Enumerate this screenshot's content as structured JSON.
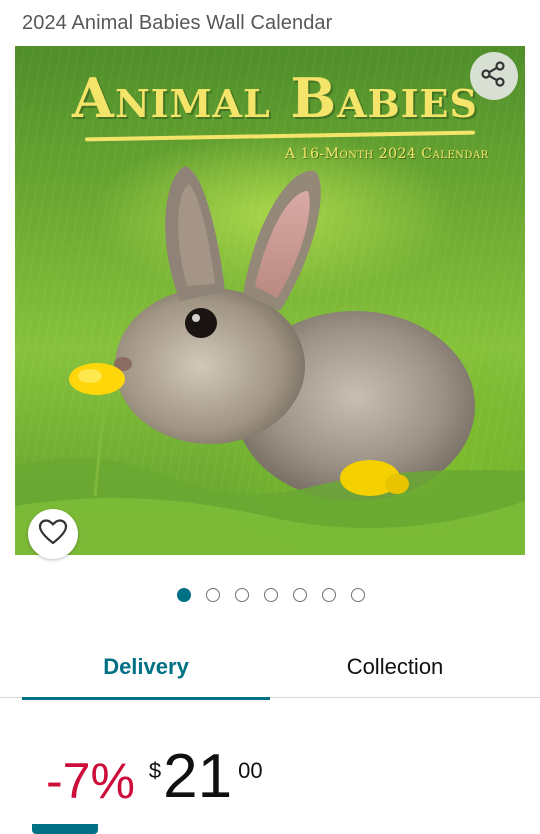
{
  "product": {
    "title": "2024 Animal Babies Wall Calendar"
  },
  "image": {
    "cover_title": "Animal Babies",
    "cover_subtitle": "A 16-Month 2024 Calendar",
    "subject": "rabbit in grass with yellow buttercups"
  },
  "actions": {
    "share_icon": "share-icon",
    "favorite_icon": "heart-outline-icon"
  },
  "carousel": {
    "total": 7,
    "active_index": 0
  },
  "tabs": {
    "delivery": "Delivery",
    "collection": "Collection",
    "selected": "Delivery"
  },
  "price": {
    "discount": "-7%",
    "currency": "$",
    "whole": "21",
    "fraction": "00"
  },
  "colors": {
    "accent": "#007185",
    "discount": "#cc0c39",
    "title_text": "#565959",
    "cover_text": "#f4e56a"
  }
}
